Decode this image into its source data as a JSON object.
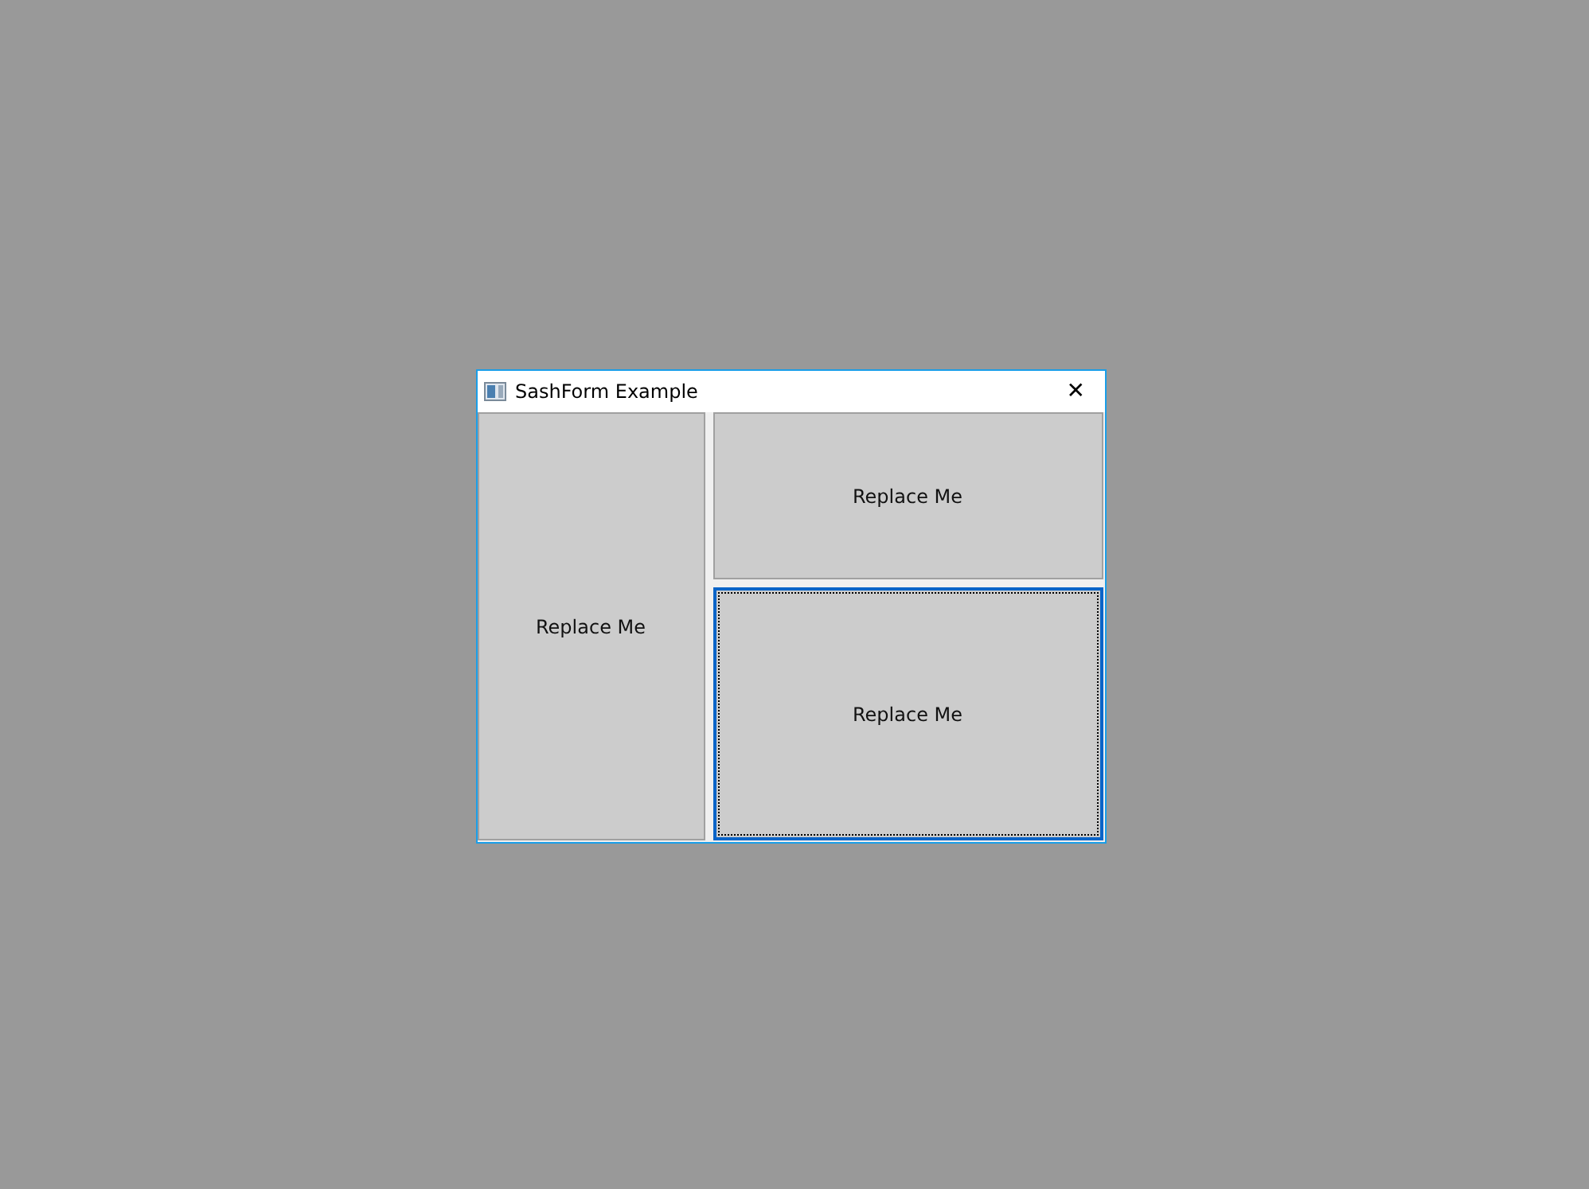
{
  "window": {
    "title": "SashForm Example",
    "close": "✕"
  },
  "panes": [
    {
      "label": "Replace Me",
      "focused": false
    },
    {
      "label": "Replace Me",
      "focused": false
    },
    {
      "label": "Replace Me",
      "focused": true
    }
  ]
}
